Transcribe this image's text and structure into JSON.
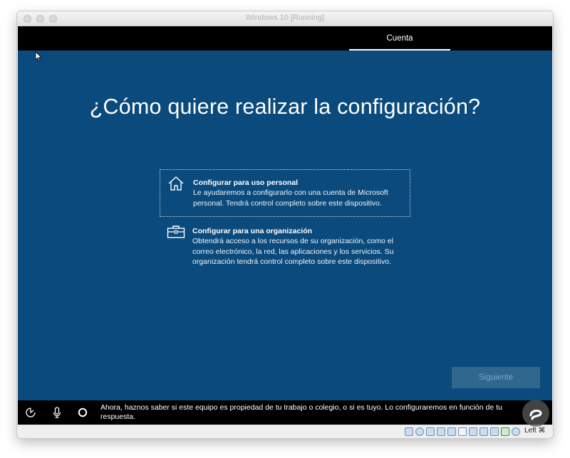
{
  "window": {
    "title": "Windows 10 [Running]"
  },
  "topbar": {
    "tab_label": "Cuenta"
  },
  "main": {
    "heading": "¿Cómo quiere realizar la configuración?",
    "options": [
      {
        "icon": "home-icon",
        "title": "Configurar para uso personal",
        "description": "Le ayudaremos a configurarlo con una cuenta de Microsoft personal. Tendrá control completo sobre este dispositivo.",
        "selected": true
      },
      {
        "icon": "briefcase-icon",
        "title": "Configurar para una organización",
        "description": "Obtendrá acceso a los recursos de su organización, como el correo electrónico, la red, las aplicaciones y los servicios. Su organización tendrá control completo sobre este dispositivo.",
        "selected": false
      }
    ],
    "next_button_label": "Siguiente"
  },
  "cortana_bar": {
    "icons": [
      "accessibility-icon",
      "microphone-icon",
      "cortana-circle-icon"
    ],
    "message": "Ahora, haznos saber si este equipo es propiedad de tu trabajo o colegio, o si es tuyo. Lo configuraremos en función de tu respuesta."
  },
  "statusbar": {
    "host_key_label": "Left ⌘"
  },
  "colors": {
    "oobe_background": "#0b4a7c",
    "bar_background": "#000000",
    "button_disabled": "#2f678f",
    "text": "#ffffff"
  }
}
